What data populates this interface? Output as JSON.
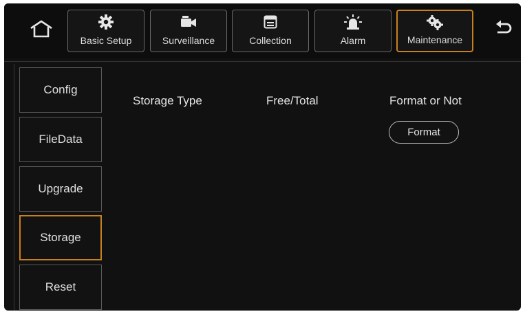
{
  "nav": {
    "home_icon": "home-icon",
    "back_icon": "back-arrow-icon",
    "tabs": [
      {
        "label": "Basic Setup",
        "icon": "gear-icon",
        "active": false
      },
      {
        "label": "Surveillance",
        "icon": "camera-icon",
        "active": false
      },
      {
        "label": "Collection",
        "icon": "window-icon",
        "active": false
      },
      {
        "label": "Alarm",
        "icon": "alarm-light-icon",
        "active": false
      },
      {
        "label": "Maintenance",
        "icon": "gears-icon",
        "active": true
      }
    ]
  },
  "sidebar": {
    "items": [
      {
        "label": "Config",
        "active": false
      },
      {
        "label": "FileData",
        "active": false
      },
      {
        "label": "Upgrade",
        "active": false
      },
      {
        "label": "Storage",
        "active": true
      },
      {
        "label": "Reset",
        "active": false
      }
    ]
  },
  "main": {
    "columns": {
      "storage_type": "Storage Type",
      "free_total": "Free/Total",
      "format_or_not": "Format or Not"
    },
    "format_button": "Format"
  },
  "colors": {
    "background": "#111111",
    "accent": "#c8801e",
    "text": "#e0e0e0"
  }
}
